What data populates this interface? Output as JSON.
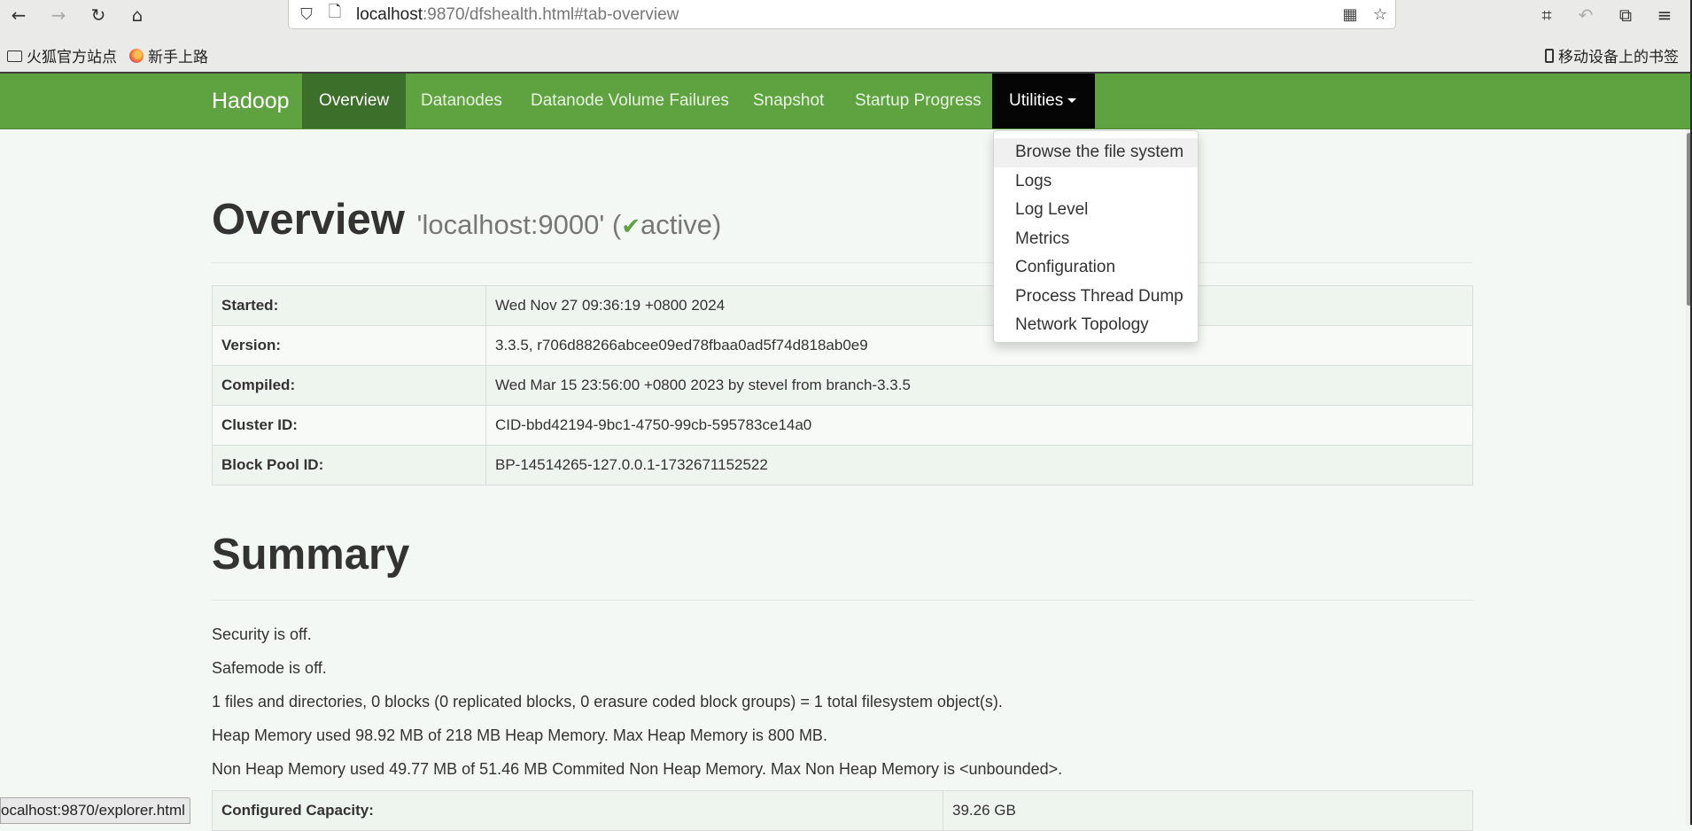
{
  "browser": {
    "url_host": "localhost",
    "url_rest": ":9870/dfshealth.html#tab-overview",
    "bookmarks": [
      "火狐官方站点",
      "新手上路"
    ],
    "mobile_bookmarks": "移动设备上的书签",
    "status_url": "ocalhost:9870/explorer.html"
  },
  "navbar": {
    "brand": "Hadoop",
    "items": [
      "Overview",
      "Datanodes",
      "Datanode Volume Failures",
      "Snapshot",
      "Startup Progress",
      "Utilities"
    ],
    "accent_color": "#5fa341"
  },
  "utilities_menu": [
    "Browse the file system",
    "Logs",
    "Log Level",
    "Metrics",
    "Configuration",
    "Process Thread Dump",
    "Network Topology"
  ],
  "overview": {
    "title": "Overview",
    "host": "'localhost:9000' (",
    "check": "✔",
    "state": "active)",
    "rows": [
      {
        "key": "Started:",
        "value": "Wed Nov 27 09:36:19 +0800 2024"
      },
      {
        "key": "Version:",
        "value": "3.3.5, r706d88266abcee09ed78fbaa0ad5f74d818ab0e9"
      },
      {
        "key": "Compiled:",
        "value": "Wed Mar 15 23:56:00 +0800 2023 by stevel from branch-3.3.5"
      },
      {
        "key": "Cluster ID:",
        "value": "CID-bbd42194-9bc1-4750-99cb-595783ce14a0"
      },
      {
        "key": "Block Pool ID:",
        "value": "BP-14514265-127.0.0.1-1732671152522"
      }
    ]
  },
  "summary": {
    "title": "Summary",
    "lines": [
      "Security is off.",
      "Safemode is off.",
      "1 files and directories, 0 blocks (0 replicated blocks, 0 erasure coded block groups) = 1 total filesystem object(s).",
      "Heap Memory used 98.92 MB of 218 MB Heap Memory. Max Heap Memory is 800 MB.",
      "Non Heap Memory used 49.77 MB of 51.46 MB Commited Non Heap Memory. Max Non Heap Memory is <unbounded>."
    ],
    "table": [
      {
        "key": "Configured Capacity:",
        "value": "39.26 GB"
      }
    ]
  }
}
